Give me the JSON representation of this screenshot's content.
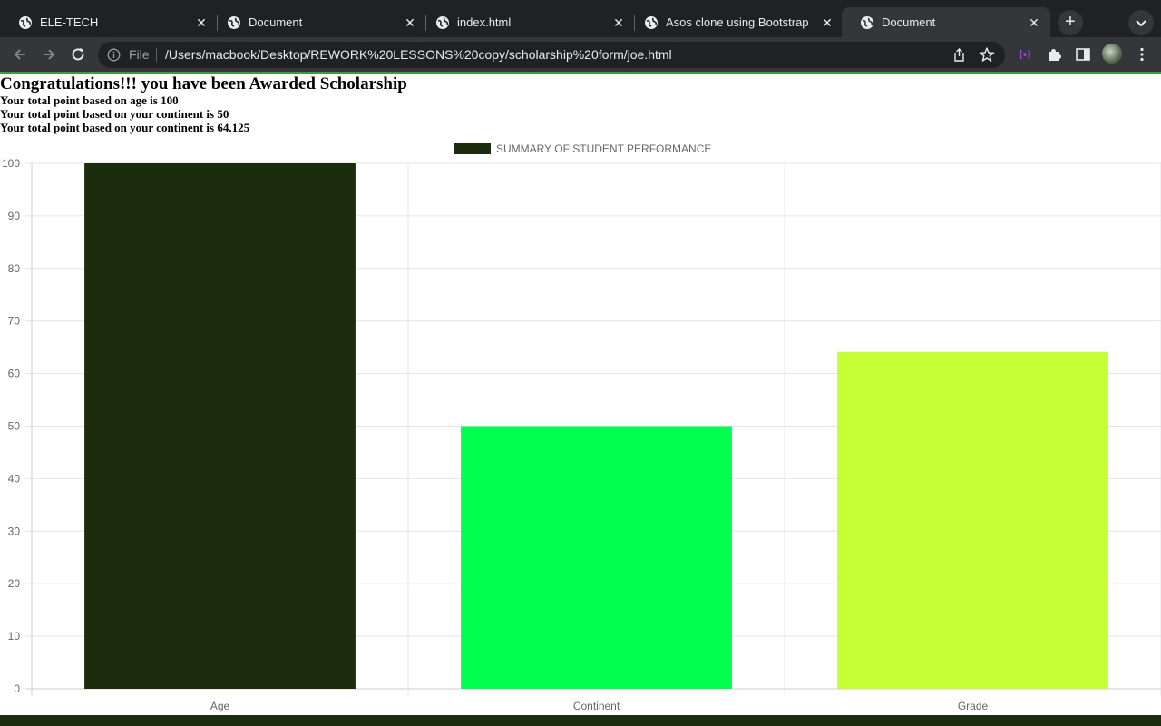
{
  "browser": {
    "tabs": [
      {
        "title": "ELE-TECH",
        "active": false
      },
      {
        "title": "Document",
        "active": false
      },
      {
        "title": "index.html",
        "active": false
      },
      {
        "title": "Asos clone using Bootstrap",
        "active": false
      },
      {
        "title": "Document",
        "active": true
      }
    ],
    "new_tab_label": "+",
    "address": {
      "scheme": "File",
      "url": "/Users/macbook/Desktop/REWORK%20LESSONS%20copy/scholarship%20form/joe.html"
    }
  },
  "page": {
    "heading": "Congratulations!!! you have been Awarded Scholarship",
    "lines": [
      "Your total point based on age is 100",
      "Your total point based on your continent is 50",
      "Your total point based on your continent is 64.125"
    ]
  },
  "chart_data": {
    "type": "bar",
    "categories": [
      "Age",
      "Continent",
      "Grade"
    ],
    "values": [
      100,
      50,
      64.125
    ],
    "colors": [
      "#1b2d0c",
      "#00ff4f",
      "#c6ff36"
    ],
    "legend": {
      "label": "SUMMARY OF STUDENT PERFORMANCE",
      "color": "#1b2d0c",
      "position": "top"
    },
    "ylim": [
      0,
      100
    ],
    "yticks": [
      0,
      10,
      20,
      30,
      40,
      50,
      60,
      70,
      80,
      90,
      100
    ],
    "grid": true
  }
}
